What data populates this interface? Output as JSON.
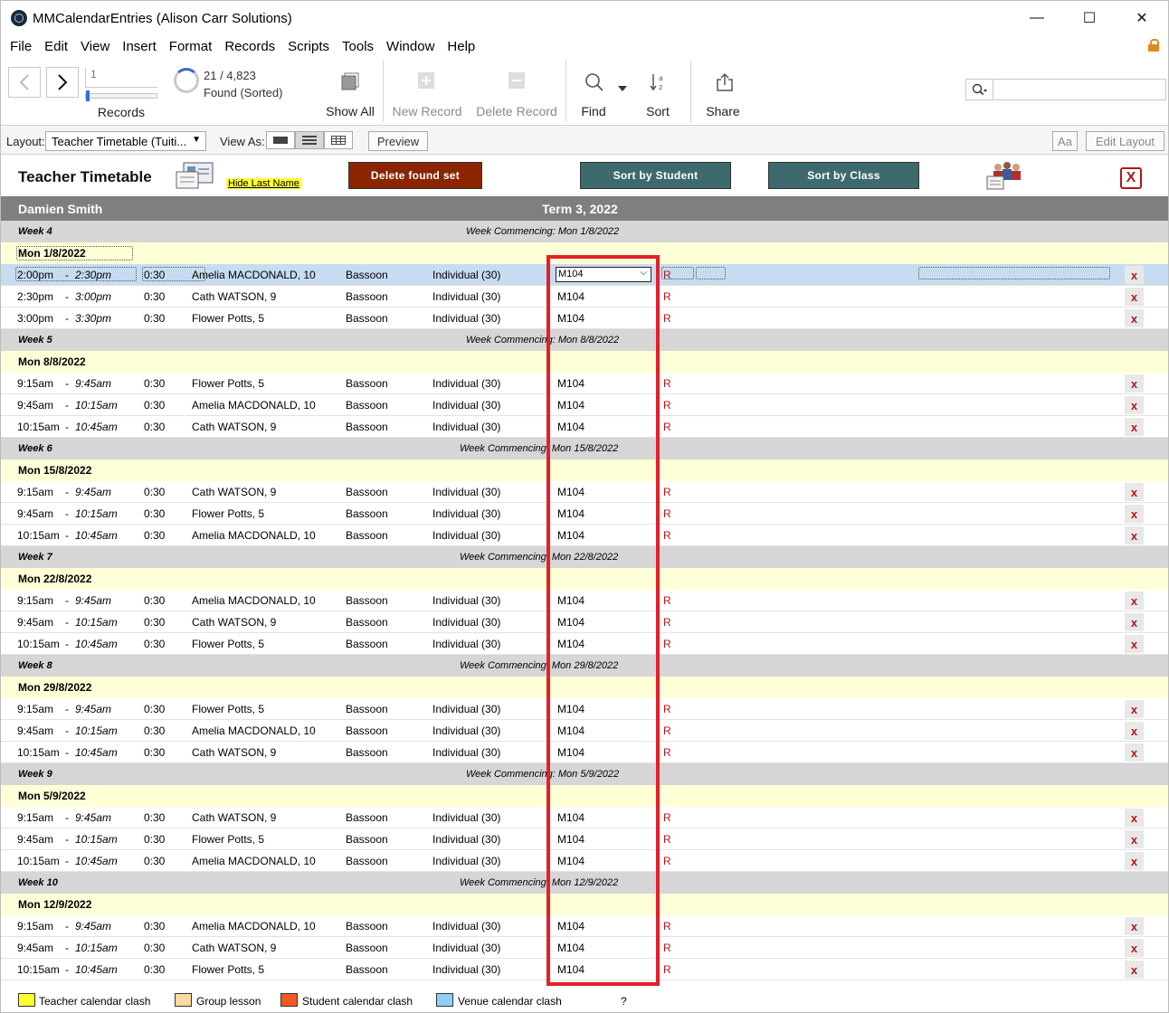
{
  "window": {
    "title": "MMCalendarEntries (Alison Carr Solutions)",
    "min_glyph": "—",
    "max_glyph": "☐",
    "close_glyph": "✕"
  },
  "menu": [
    "File",
    "Edit",
    "View",
    "Insert",
    "Format",
    "Records",
    "Scripts",
    "Tools",
    "Window",
    "Help"
  ],
  "toolbar": {
    "record_number": "1",
    "records_label": "Records",
    "found_count": "21 / 4,823",
    "found_text": "Found (Sorted)",
    "show_all": "Show All",
    "new_record": "New Record",
    "delete_record": "Delete Record",
    "find": "Find",
    "sort": "Sort",
    "share": "Share",
    "search_value": ""
  },
  "layoutbar": {
    "layout_label": "Layout:",
    "layout_value": "Teacher Timetable (Tuiti...",
    "view_as_label": "View As:",
    "preview": "Preview",
    "aa": "Aa",
    "edit_layout": "Edit Layout"
  },
  "header": {
    "title": "Teacher Timetable",
    "hide_last_name": "Hide Last Name",
    "delete_found_set": "Delete found set",
    "sort_by_student": "Sort by Student",
    "sort_by_class": "Sort by Class",
    "close": "X",
    "colors": {
      "delete": "#8b2500",
      "sort": "#3d6a6e"
    }
  },
  "teacher_bar": {
    "teacher": "Damien Smith",
    "term": "Term 3, 2022"
  },
  "weeks": [
    {
      "week": "Week 4",
      "commencing": "Week Commencing: Mon 1/8/2022",
      "day": "Mon   1/8/2022",
      "entries": [
        {
          "start": "2:00pm",
          "end": "2:30pm",
          "dur": "0:30",
          "student": "Amelia MACDONALD, 10",
          "instrument": "Bassoon",
          "type": "Individual (30)",
          "room": "M104",
          "mark": "R",
          "del": "x"
        },
        {
          "start": "2:30pm",
          "end": "3:00pm",
          "dur": "0:30",
          "student": "Cath WATSON, 9",
          "instrument": "Bassoon",
          "type": "Individual (30)",
          "room": "M104",
          "mark": "R",
          "del": "x"
        },
        {
          "start": "3:00pm",
          "end": "3:30pm",
          "dur": "0:30",
          "student": "Flower Potts, 5",
          "instrument": "Bassoon",
          "type": "Individual (30)",
          "room": "M104",
          "mark": "R",
          "del": "x"
        }
      ]
    },
    {
      "week": "Week 5",
      "commencing": "Week Commencing: Mon 8/8/2022",
      "day": "Mon   8/8/2022",
      "entries": [
        {
          "start": "9:15am",
          "end": "9:45am",
          "dur": "0:30",
          "student": "Flower Potts, 5",
          "instrument": "Bassoon",
          "type": "Individual (30)",
          "room": "M104",
          "mark": "R",
          "del": "x"
        },
        {
          "start": "9:45am",
          "end": "10:15am",
          "dur": "0:30",
          "student": "Amelia MACDONALD, 10",
          "instrument": "Bassoon",
          "type": "Individual (30)",
          "room": "M104",
          "mark": "R",
          "del": "x"
        },
        {
          "start": "10:15am",
          "end": "10:45am",
          "dur": "0:30",
          "student": "Cath WATSON, 9",
          "instrument": "Bassoon",
          "type": "Individual (30)",
          "room": "M104",
          "mark": "R",
          "del": "x"
        }
      ]
    },
    {
      "week": "Week 6",
      "commencing": "Week Commencing: Mon 15/8/2022",
      "day": "Mon   15/8/2022",
      "entries": [
        {
          "start": "9:15am",
          "end": "9:45am",
          "dur": "0:30",
          "student": "Cath WATSON, 9",
          "instrument": "Bassoon",
          "type": "Individual (30)",
          "room": "M104",
          "mark": "R",
          "del": "x"
        },
        {
          "start": "9:45am",
          "end": "10:15am",
          "dur": "0:30",
          "student": "Flower Potts, 5",
          "instrument": "Bassoon",
          "type": "Individual (30)",
          "room": "M104",
          "mark": "R",
          "del": "x"
        },
        {
          "start": "10:15am",
          "end": "10:45am",
          "dur": "0:30",
          "student": "Amelia MACDONALD, 10",
          "instrument": "Bassoon",
          "type": "Individual (30)",
          "room": "M104",
          "mark": "R",
          "del": "x"
        }
      ]
    },
    {
      "week": "Week 7",
      "commencing": "Week Commencing: Mon 22/8/2022",
      "day": "Mon   22/8/2022",
      "entries": [
        {
          "start": "9:15am",
          "end": "9:45am",
          "dur": "0:30",
          "student": "Amelia MACDONALD, 10",
          "instrument": "Bassoon",
          "type": "Individual (30)",
          "room": "M104",
          "mark": "R",
          "del": "x"
        },
        {
          "start": "9:45am",
          "end": "10:15am",
          "dur": "0:30",
          "student": "Cath WATSON, 9",
          "instrument": "Bassoon",
          "type": "Individual (30)",
          "room": "M104",
          "mark": "R",
          "del": "x"
        },
        {
          "start": "10:15am",
          "end": "10:45am",
          "dur": "0:30",
          "student": "Flower Potts, 5",
          "instrument": "Bassoon",
          "type": "Individual (30)",
          "room": "M104",
          "mark": "R",
          "del": "x"
        }
      ]
    },
    {
      "week": "Week 8",
      "commencing": "Week Commencing: Mon 29/8/2022",
      "day": "Mon   29/8/2022",
      "entries": [
        {
          "start": "9:15am",
          "end": "9:45am",
          "dur": "0:30",
          "student": "Flower Potts, 5",
          "instrument": "Bassoon",
          "type": "Individual (30)",
          "room": "M104",
          "mark": "R",
          "del": "x"
        },
        {
          "start": "9:45am",
          "end": "10:15am",
          "dur": "0:30",
          "student": "Amelia MACDONALD, 10",
          "instrument": "Bassoon",
          "type": "Individual (30)",
          "room": "M104",
          "mark": "R",
          "del": "x"
        },
        {
          "start": "10:15am",
          "end": "10:45am",
          "dur": "0:30",
          "student": "Cath WATSON, 9",
          "instrument": "Bassoon",
          "type": "Individual (30)",
          "room": "M104",
          "mark": "R",
          "del": "x"
        }
      ]
    },
    {
      "week": "Week 9",
      "commencing": "Week Commencing: Mon 5/9/2022",
      "day": "Mon   5/9/2022",
      "entries": [
        {
          "start": "9:15am",
          "end": "9:45am",
          "dur": "0:30",
          "student": "Cath WATSON, 9",
          "instrument": "Bassoon",
          "type": "Individual (30)",
          "room": "M104",
          "mark": "R",
          "del": "x"
        },
        {
          "start": "9:45am",
          "end": "10:15am",
          "dur": "0:30",
          "student": "Flower Potts, 5",
          "instrument": "Bassoon",
          "type": "Individual (30)",
          "room": "M104",
          "mark": "R",
          "del": "x"
        },
        {
          "start": "10:15am",
          "end": "10:45am",
          "dur": "0:30",
          "student": "Amelia MACDONALD, 10",
          "instrument": "Bassoon",
          "type": "Individual (30)",
          "room": "M104",
          "mark": "R",
          "del": "x"
        }
      ]
    },
    {
      "week": "Week 10",
      "commencing": "Week Commencing: Mon 12/9/2022",
      "day": "Mon   12/9/2022",
      "entries": [
        {
          "start": "9:15am",
          "end": "9:45am",
          "dur": "0:30",
          "student": "Amelia MACDONALD, 10",
          "instrument": "Bassoon",
          "type": "Individual (30)",
          "room": "M104",
          "mark": "R",
          "del": "x"
        },
        {
          "start": "9:45am",
          "end": "10:15am",
          "dur": "0:30",
          "student": "Cath WATSON, 9",
          "instrument": "Bassoon",
          "type": "Individual (30)",
          "room": "M104",
          "mark": "R",
          "del": "x"
        },
        {
          "start": "10:15am",
          "end": "10:45am",
          "dur": "0:30",
          "student": "Flower Potts, 5",
          "instrument": "Bassoon",
          "type": "Individual (30)",
          "room": "M104",
          "mark": "R",
          "del": "x"
        }
      ]
    }
  ],
  "legend": [
    {
      "label": "Teacher calendar clash",
      "color": "#ffff33"
    },
    {
      "label": "Group lesson",
      "color": "#fbd9a0"
    },
    {
      "label": "Student calendar clash",
      "color": "#f25a1e"
    },
    {
      "label": "Venue calendar clash",
      "color": "#8fd0f5"
    }
  ],
  "legend_help": "?"
}
